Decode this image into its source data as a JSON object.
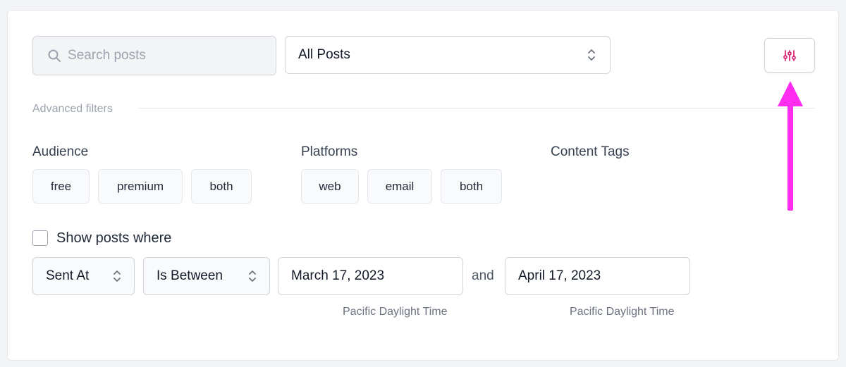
{
  "search": {
    "placeholder": "Search posts",
    "icon": "search-icon"
  },
  "posts_filter": {
    "selected": "All Posts"
  },
  "filter_toggle": {
    "icon": "sliders-icon",
    "color": "#db2777"
  },
  "advanced_filters": {
    "label": "Advanced filters",
    "audience": {
      "title": "Audience",
      "options": [
        "free",
        "premium",
        "both"
      ]
    },
    "platforms": {
      "title": "Platforms",
      "options": [
        "web",
        "email",
        "both"
      ]
    },
    "content_tags": {
      "title": "Content Tags"
    }
  },
  "condition": {
    "checkbox_label": "Show posts where",
    "field": "Sent At",
    "operator": "Is Between",
    "start_date": "March 17, 2023",
    "joiner": "and",
    "end_date": "April 17, 2023",
    "start_timezone": "Pacific Daylight Time",
    "end_timezone": "Pacific Daylight Time"
  },
  "annotation": {
    "arrow_color": "#ff2bf0"
  }
}
